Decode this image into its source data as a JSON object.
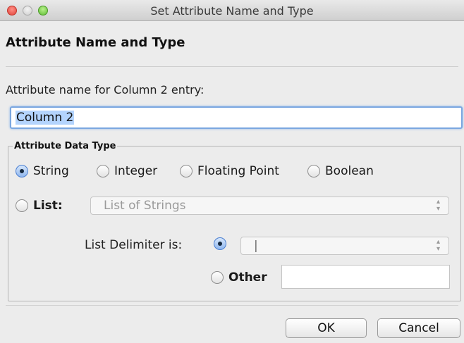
{
  "window": {
    "title": "Set Attribute Name and Type"
  },
  "dialog": {
    "heading": "Attribute Name and Type",
    "name_prompt": "Attribute name for Column 2 entry:",
    "name_value": "Column 2"
  },
  "data_type": {
    "group_label": "Attribute Data Type",
    "options": [
      {
        "label": "String",
        "selected": true
      },
      {
        "label": "Integer",
        "selected": false
      },
      {
        "label": "Floating Point",
        "selected": false
      },
      {
        "label": "Boolean",
        "selected": false
      }
    ],
    "list": {
      "label": "List:",
      "selected": false,
      "combo_value": "List of Strings"
    },
    "delimiter": {
      "label": "List Delimiter is:",
      "combo_value": "|",
      "preset_selected": true,
      "other_label": "Other",
      "other_value": ""
    }
  },
  "buttons": {
    "ok": "OK",
    "cancel": "Cancel"
  },
  "icons": {
    "close": "close-traffic-light-icon",
    "minimize": "minimize-traffic-light-icon",
    "maximize": "zoom-traffic-light-icon",
    "combo_arrows": "up-down-chevron-icon"
  },
  "colors": {
    "focus_ring": "#7ba7e0",
    "selection": "#b4d4fd",
    "close": "#e0443a",
    "zoom": "#5fbd35"
  }
}
